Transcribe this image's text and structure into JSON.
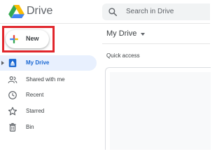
{
  "header": {
    "app_title": "Drive",
    "search": {
      "placeholder": "Search in Drive"
    }
  },
  "new_button": {
    "label": "New",
    "highlight_color": "#e1262c"
  },
  "sidebar": {
    "items": [
      {
        "label": "My Drive",
        "icon": "my-drive-icon",
        "active": true
      },
      {
        "label": "Shared with me",
        "icon": "people-icon",
        "active": false
      },
      {
        "label": "Recent",
        "icon": "clock-icon",
        "active": false
      },
      {
        "label": "Starred",
        "icon": "star-icon",
        "active": false
      },
      {
        "label": "Bin",
        "icon": "trash-icon",
        "active": false
      }
    ]
  },
  "main": {
    "title": "My Drive",
    "quick_access_label": "Quick access"
  },
  "colors": {
    "accent": "#1967d2",
    "active_bg": "#e8f0fe",
    "google_blue": "#4285f4",
    "google_red": "#ea4335",
    "google_yellow": "#fbbc04",
    "google_green": "#34a853"
  }
}
